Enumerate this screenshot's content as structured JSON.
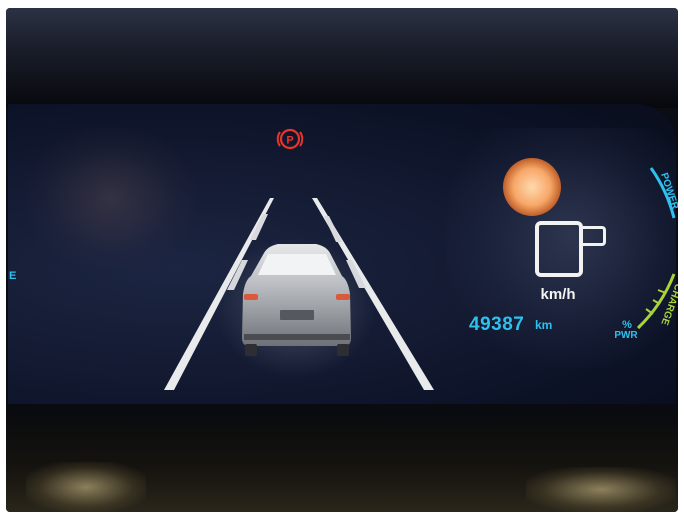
{
  "dashboard": {
    "parking_brake_icon": "parking-brake-warning-icon",
    "parking_brake_symbol": "P",
    "warning_color": "#e8342a",
    "speed_unit": "km/h",
    "odometer_value": "49387",
    "odometer_unit": "km",
    "power_percent_symbol": "%",
    "power_label": "PWR",
    "gauge_label_top": "POWER",
    "gauge_label_bottom": "CHARGE",
    "left_edge_letter": "E",
    "gauge_colors": {
      "power": "#2ec0ee",
      "charge": "#a8d43a"
    },
    "accent_color": "#2ec0ee"
  }
}
